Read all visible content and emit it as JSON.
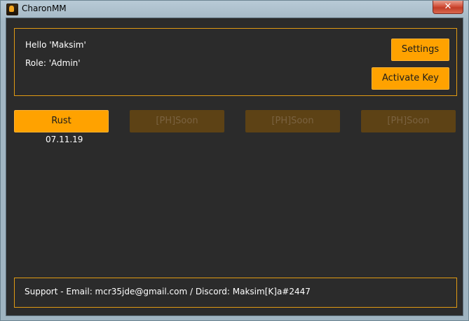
{
  "window": {
    "title": "CharonMM",
    "close_label": "✕"
  },
  "header": {
    "greeting": "Hello 'Maksim'",
    "role": "Role: 'Admin'",
    "settings_label": "Settings",
    "activate_label": "Activate Key"
  },
  "games": [
    {
      "label": "Rust",
      "date": "07.11.19",
      "enabled": true
    },
    {
      "label": "[PH]Soon",
      "enabled": false
    },
    {
      "label": "[PH]Soon",
      "enabled": false
    },
    {
      "label": "[PH]Soon",
      "enabled": false
    }
  ],
  "footer": {
    "support": "Support - Email: mcr35jde@gmail.com / Discord: Maksim[K]a#2447"
  },
  "colors": {
    "accent": "#ffa200",
    "background": "#2b2b2b",
    "disabled": "#5d4215"
  }
}
